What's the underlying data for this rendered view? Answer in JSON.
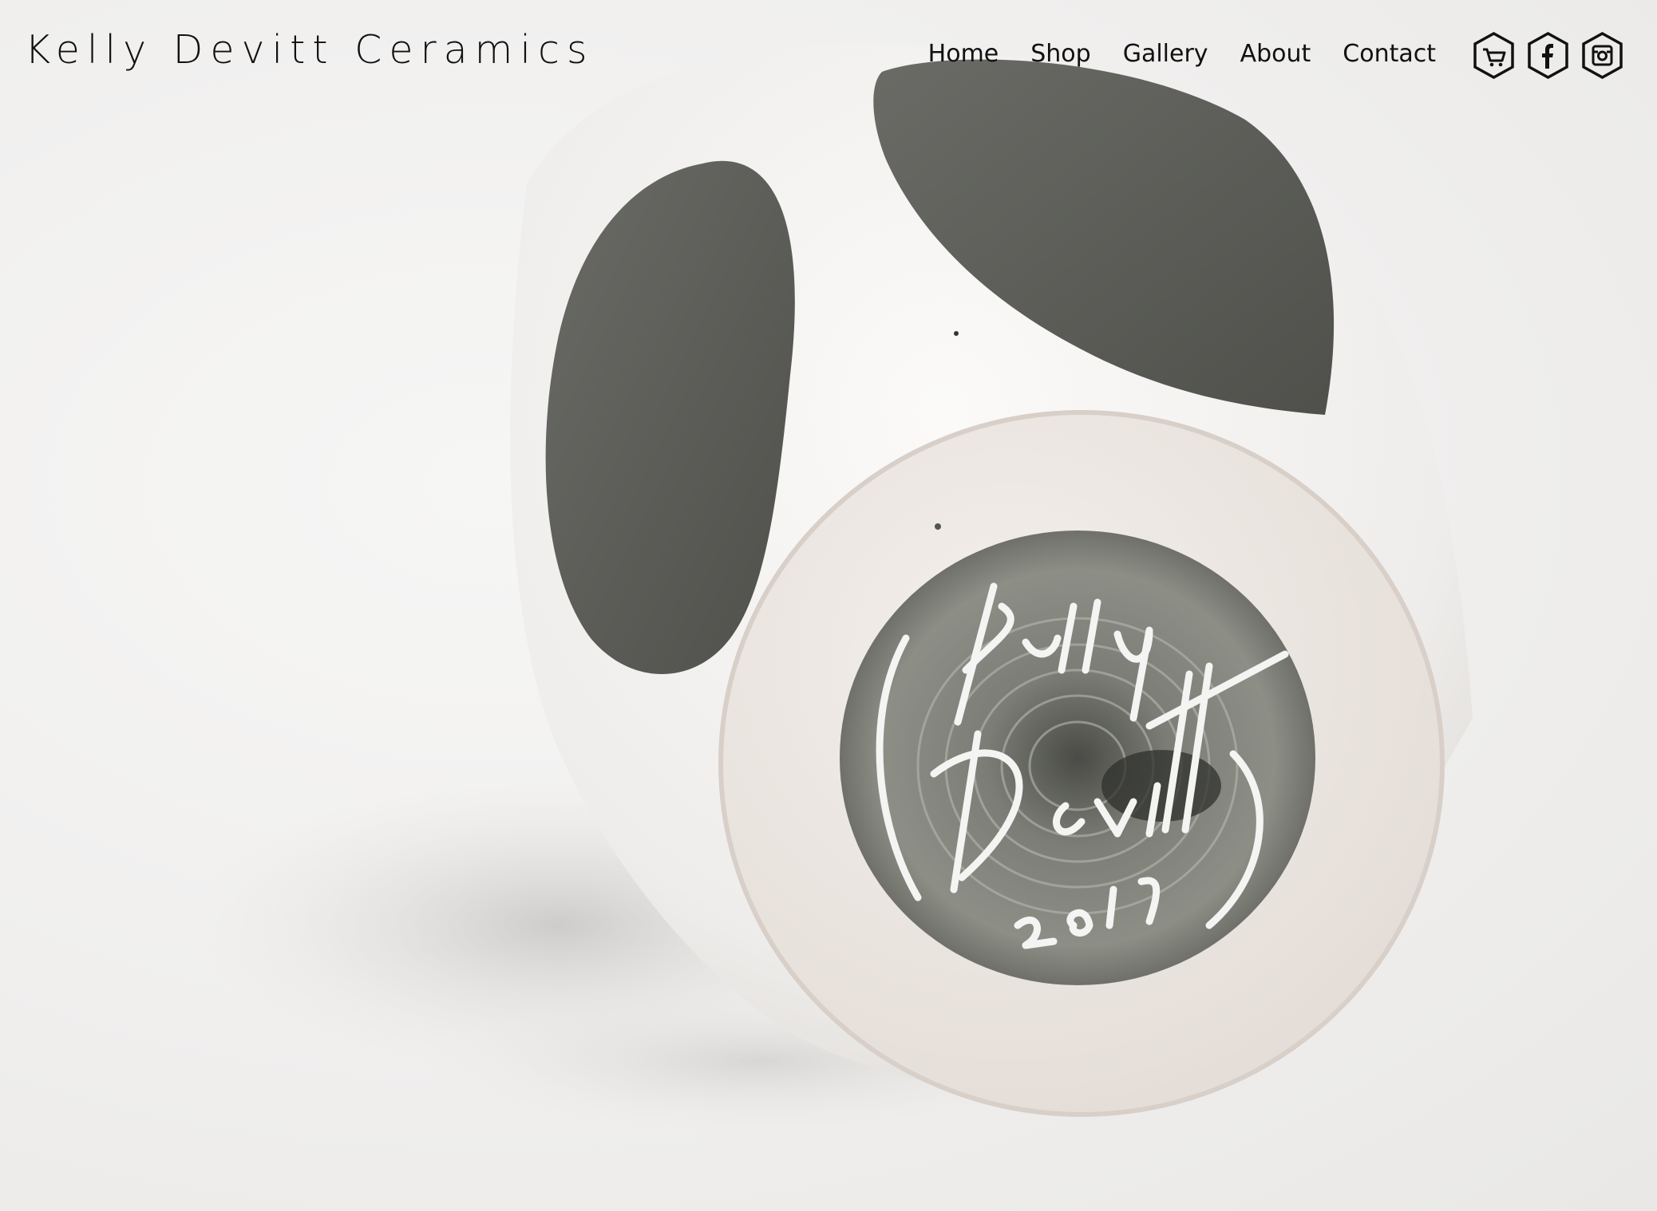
{
  "site": {
    "title": "Kelly Devitt Ceramics"
  },
  "nav": {
    "items": [
      {
        "label": "Home"
      },
      {
        "label": "Shop"
      },
      {
        "label": "Gallery"
      },
      {
        "label": "About"
      },
      {
        "label": "Contact"
      }
    ]
  },
  "social": {
    "items": [
      {
        "icon": "cart-icon"
      },
      {
        "icon": "facebook-icon"
      },
      {
        "icon": "instagram-icon"
      }
    ]
  },
  "hero": {
    "signature": [
      "Kelly",
      "Devitt",
      "2017"
    ]
  },
  "colors": {
    "text": "#111111",
    "background": "#f1f1f0",
    "glaze": "#5b5c57",
    "clay": "#ece6e1"
  }
}
